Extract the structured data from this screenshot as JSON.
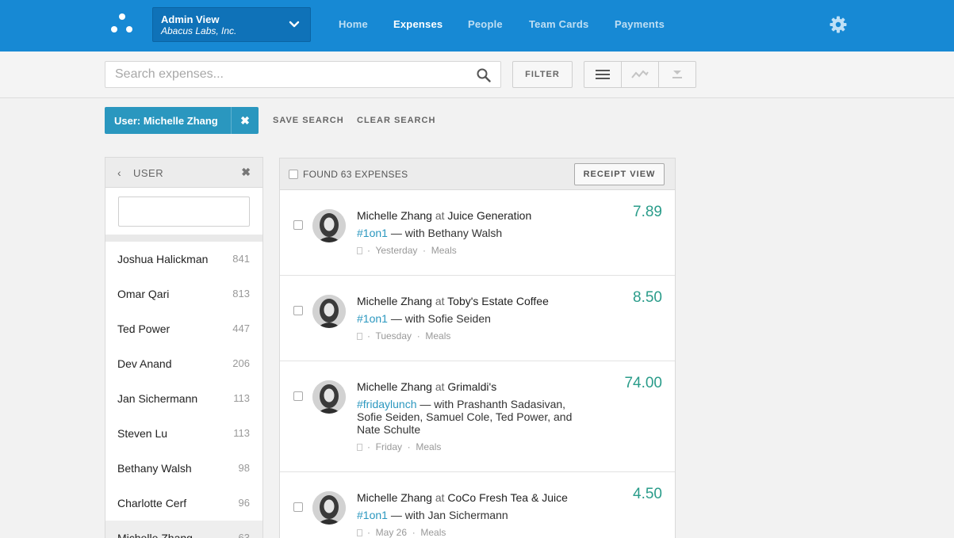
{
  "header": {
    "account": {
      "view": "Admin View",
      "company": "Abacus Labs, Inc."
    },
    "nav": [
      {
        "label": "Home",
        "active": false
      },
      {
        "label": "Expenses",
        "active": true
      },
      {
        "label": "People",
        "active": false
      },
      {
        "label": "Team Cards",
        "active": false
      },
      {
        "label": "Payments",
        "active": false
      }
    ],
    "settings_icon": "gear-icon"
  },
  "toolbar": {
    "search_placeholder": "Search expenses...",
    "filter_label": "FILTER",
    "view_icons": [
      "list-view-icon",
      "trend-chart-icon",
      "download-icon"
    ]
  },
  "active_filters": {
    "chip_label": "User: Michelle Zhang",
    "chip_remove": "✖",
    "save_label": "SAVE SEARCH",
    "clear_label": "CLEAR SEARCH"
  },
  "user_panel": {
    "title": "USER",
    "back": "‹",
    "close": "✖",
    "filter_value": "",
    "users": [
      {
        "name": "Joshua Halickman",
        "count": "841"
      },
      {
        "name": "Omar Qari",
        "count": "813"
      },
      {
        "name": "Ted Power",
        "count": "447"
      },
      {
        "name": "Dev Anand",
        "count": "206"
      },
      {
        "name": "Jan Sichermann",
        "count": "113"
      },
      {
        "name": "Steven Lu",
        "count": "113"
      },
      {
        "name": "Bethany Walsh",
        "count": "98"
      },
      {
        "name": "Charlotte Cerf",
        "count": "96"
      },
      {
        "name": "Michelle Zhang",
        "count": "63"
      }
    ]
  },
  "expenses": {
    "found_label": "FOUND 63 EXPENSES",
    "receipt_view_label": "RECEIPT VIEW",
    "items": [
      {
        "user": "Michelle Zhang",
        "at": "at",
        "merchant": "Juice Generation",
        "tag": "#1on1",
        "with": "— with Bethany Walsh",
        "date": "Yesterday",
        "category": "Meals",
        "amount": "7.89"
      },
      {
        "user": "Michelle Zhang",
        "at": "at",
        "merchant": "Toby's Estate Coffee",
        "tag": "#1on1",
        "with": "— with Sofie Seiden",
        "date": "Tuesday",
        "category": "Meals",
        "amount": "8.50"
      },
      {
        "user": "Michelle Zhang",
        "at": "at",
        "merchant": "Grimaldi's",
        "tag": "#fridaylunch",
        "with": "— with Prashanth Sadasivan, Sofie Seiden, Samuel Cole, Ted Power, and Nate Schulte",
        "date": "Friday",
        "category": "Meals",
        "amount": "74.00"
      },
      {
        "user": "Michelle Zhang",
        "at": "at",
        "merchant": "CoCo Fresh Tea & Juice",
        "tag": "#1on1",
        "with": "— with Jan Sichermann",
        "date": "May 26",
        "category": "Meals",
        "amount": "4.50"
      }
    ]
  },
  "colors": {
    "header_bg": "#1789d4",
    "chip_bg": "#2a97bf",
    "amount": "#2a9c8a",
    "tag": "#2a97bf"
  }
}
